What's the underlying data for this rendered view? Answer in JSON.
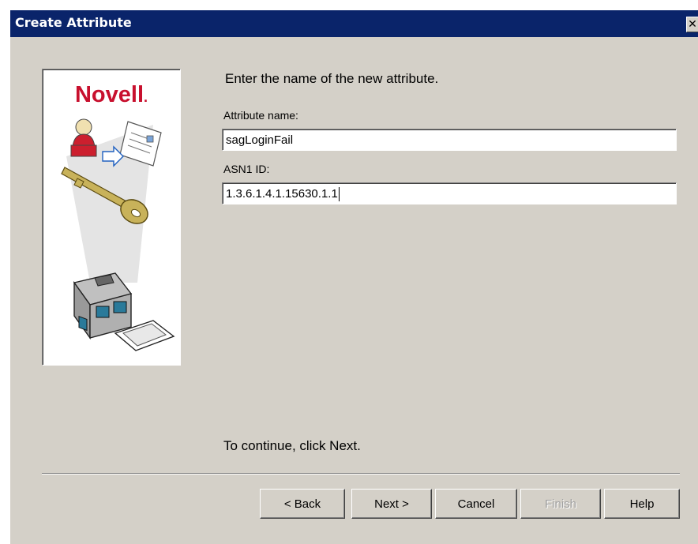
{
  "window": {
    "title": "Create Attribute",
    "close_glyph": "✕"
  },
  "banner": {
    "brand": "Novell",
    "brand_dot": ".",
    "brand_color": "#c8102e",
    "icons": [
      "user-icon",
      "envelope-icon",
      "key-icon",
      "server-icon"
    ]
  },
  "form": {
    "prompt": "Enter the name of the new attribute.",
    "attribute_name_label": "Attribute name:",
    "attribute_name_value": "sagLoginFail",
    "asn1_label": "ASN1 ID:",
    "asn1_value": "1.3.6.1.4.1.15630.1.1"
  },
  "footer": {
    "continue_text": "To continue, click Next."
  },
  "buttons": {
    "back": "< Back",
    "next": "Next >",
    "cancel": "Cancel",
    "finish": "Finish",
    "help": "Help"
  }
}
